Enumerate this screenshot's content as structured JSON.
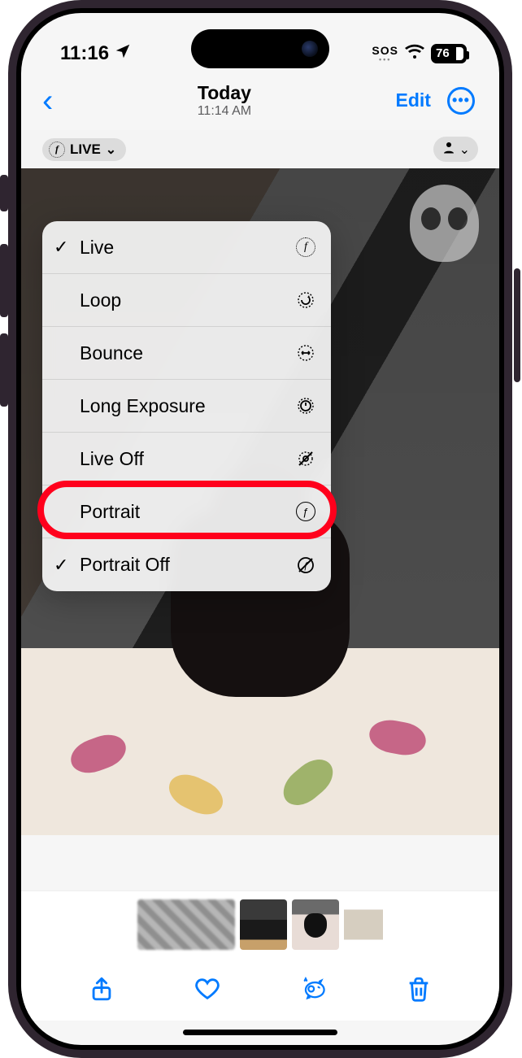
{
  "status": {
    "time": "11:16",
    "sos": "SOS",
    "battery": "76"
  },
  "nav": {
    "title": "Today",
    "subtitle": "11:14 AM",
    "edit": "Edit"
  },
  "live_badge": {
    "label": "LIVE"
  },
  "menu": {
    "live": "Live",
    "loop": "Loop",
    "bounce": "Bounce",
    "long_exposure": "Long Exposure",
    "live_off": "Live Off",
    "portrait": "Portrait",
    "portrait_off": "Portrait Off"
  },
  "highlight_target": "portrait",
  "colors": {
    "accent": "#007aff",
    "highlight": "#ff001c"
  }
}
